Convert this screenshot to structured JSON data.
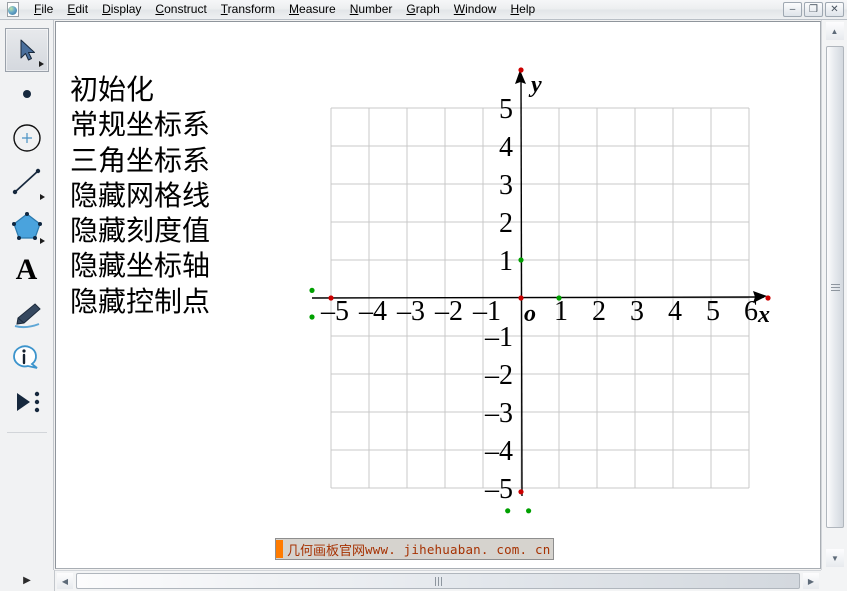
{
  "window": {
    "app_icon": "sketchpad-document-icon",
    "controls": [
      {
        "name": "minimize",
        "glyph": "–"
      },
      {
        "name": "restore",
        "glyph": "❐"
      },
      {
        "name": "close",
        "glyph": "✕"
      }
    ]
  },
  "menubar": {
    "items": [
      {
        "label": "File",
        "accel": "F"
      },
      {
        "label": "Edit",
        "accel": "E"
      },
      {
        "label": "Display",
        "accel": "D"
      },
      {
        "label": "Construct",
        "accel": "C"
      },
      {
        "label": "Transform",
        "accel": "T"
      },
      {
        "label": "Measure",
        "accel": "M"
      },
      {
        "label": "Number",
        "accel": "N"
      },
      {
        "label": "Graph",
        "accel": "G"
      },
      {
        "label": "Window",
        "accel": "W"
      },
      {
        "label": "Help",
        "accel": "H"
      }
    ]
  },
  "toolbar": {
    "tools": [
      {
        "name": "arrow-select-tool",
        "icon": "arrow-icon",
        "selected": true,
        "has_flyout": true
      },
      {
        "name": "point-tool",
        "icon": "point-icon",
        "selected": false,
        "has_flyout": false
      },
      {
        "name": "compass-tool",
        "icon": "circle-icon",
        "selected": false,
        "has_flyout": false
      },
      {
        "name": "straightedge-tool",
        "icon": "line-icon",
        "selected": false,
        "has_flyout": true
      },
      {
        "name": "polygon-tool",
        "icon": "polygon-icon",
        "selected": false,
        "has_flyout": true
      },
      {
        "name": "text-tool",
        "icon": "letter-a-icon",
        "selected": false,
        "has_flyout": false
      },
      {
        "name": "marker-tool",
        "icon": "marker-pen-icon",
        "selected": false,
        "has_flyout": false
      },
      {
        "name": "information-tool",
        "icon": "info-bubble-icon",
        "selected": false,
        "has_flyout": false
      },
      {
        "name": "custom-tool",
        "icon": "play-dots-icon",
        "selected": false,
        "has_flyout": false
      }
    ]
  },
  "sketch": {
    "action_list": [
      "初始化",
      "常规坐标系",
      "三角坐标系",
      "隐藏网格线",
      "隐藏刻度值",
      "隐藏坐标轴",
      "隐藏控制点"
    ],
    "origin_label": "o",
    "x_axis_label": "x",
    "y_axis_label": "y"
  },
  "chart_data": {
    "type": "scatter",
    "title": "",
    "xlabel": "x",
    "ylabel": "y",
    "origin_label": "o",
    "xlim": [
      -5.5,
      6.5
    ],
    "ylim": [
      -5.5,
      5.5
    ],
    "x_ticks": [
      -5,
      -4,
      -3,
      -2,
      -1,
      1,
      2,
      3,
      4,
      5,
      6
    ],
    "y_ticks": [
      5,
      4,
      3,
      2,
      1,
      -1,
      -2,
      -3,
      -4,
      -5
    ],
    "x_tick_labels": [
      "–5",
      "–4",
      "–3",
      "–2",
      "–1",
      "1",
      "2",
      "3",
      "4",
      "5",
      "6"
    ],
    "y_tick_labels": [
      "5",
      "4",
      "3",
      "2",
      "1",
      "–1",
      "–2",
      "–3",
      "–4",
      "–5"
    ],
    "grid": true,
    "grid_color": "#c8c8c8",
    "grid_x_range": [
      -5,
      6
    ],
    "grid_y_range": [
      -5,
      5
    ],
    "axis_color": "#000000",
    "legend": "none",
    "series": [],
    "control_points": [
      {
        "name": "origin-point",
        "x": 0,
        "y": 0,
        "color": "#cc0000"
      },
      {
        "name": "unit-point-x",
        "x": 1,
        "y": 0,
        "color": "#00a000"
      },
      {
        "name": "unit-point-y",
        "x": 0,
        "y": 1,
        "color": "#00a000"
      },
      {
        "name": "x-axis-arrow-point",
        "x": 6.5,
        "y": 0,
        "color": "#cc0000"
      },
      {
        "name": "x-axis-left-point",
        "x": -5,
        "y": 0,
        "color": "#cc0000"
      },
      {
        "name": "y-axis-arrow-point",
        "x": 0,
        "y": 6,
        "color": "#cc0000"
      },
      {
        "name": "y-axis-bottom-point",
        "x": 0,
        "y": -5.1,
        "color": "#cc0000"
      },
      {
        "name": "free-point-a",
        "x": -5.5,
        "y": 0.2,
        "color": "#00a000"
      },
      {
        "name": "free-point-b",
        "x": -5.5,
        "y": -0.5,
        "color": "#00a000"
      },
      {
        "name": "free-point-c",
        "x": -0.35,
        "y": -5.6,
        "color": "#00a000"
      },
      {
        "name": "free-point-d",
        "x": 0.2,
        "y": -5.6,
        "color": "#00a000"
      }
    ]
  },
  "watermark": {
    "cjk": "几何画板官网",
    "url": "www. jihehuaban. com. cn"
  },
  "scrollbars": {
    "vertical": {
      "up": "▲",
      "down": "▼"
    },
    "horizontal": {
      "left": "◀",
      "right": "▶"
    }
  }
}
